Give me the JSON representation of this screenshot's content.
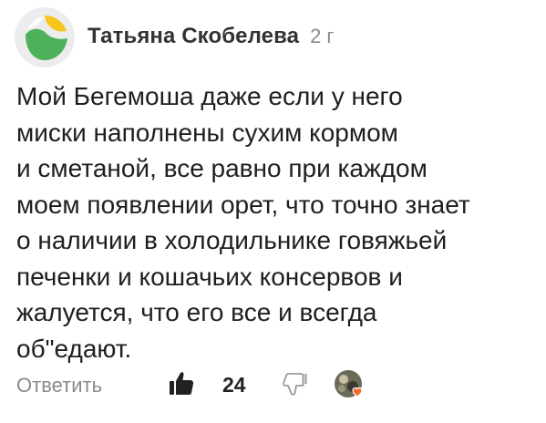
{
  "comment": {
    "author": "Татьяна Скобелева",
    "time": "2 г",
    "text_lines": [
      "Мой Бегемоша даже если у него",
      "миски наполнены сухим кормом",
      "и сметаной, все равно при каждом",
      "моем появлении орет, что точно знает",
      "о наличии в холодильнике  говяжьей",
      "печенки и кошачьих  консервов и",
      "жалуется, что его все  и всегда",
      "об\"едают."
    ],
    "reply_label": "Ответить",
    "like_count": "24"
  },
  "icons": {
    "avatar": "avatar-logo-icon",
    "like": "thumbs-up-icon",
    "dislike": "thumbs-down-icon",
    "reaction": "reactor-avatar-heart-icon"
  },
  "colors": {
    "avatar_yellow": "#f6c61b",
    "avatar_green": "#4fb05c",
    "heart": "#f26b2c"
  }
}
